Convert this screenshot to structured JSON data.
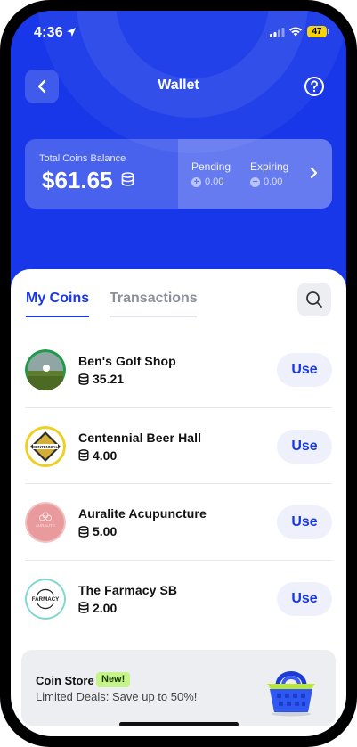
{
  "status_bar": {
    "time": "4:36",
    "battery": "47"
  },
  "header": {
    "title": "Wallet"
  },
  "balance": {
    "label": "Total Coins Balance",
    "amount": "$61.65",
    "pending_label": "Pending",
    "pending_value": "0.00",
    "expiring_label": "Expiring",
    "expiring_value": "0.00"
  },
  "tabs": {
    "my_coins": "My Coins",
    "transactions": "Transactions"
  },
  "merchants": [
    {
      "name": "Ben's Golf Shop",
      "coins": "35.21",
      "use": "Use",
      "icon": "golf-ball-icon"
    },
    {
      "name": "Centennial Beer Hall",
      "coins": "4.00",
      "use": "Use",
      "icon": "centennial-logo"
    },
    {
      "name": "Auralite Acupuncture",
      "coins": "5.00",
      "use": "Use",
      "icon": "auralite-logo"
    },
    {
      "name": "The Farmacy SB",
      "coins": "2.00",
      "use": "Use",
      "icon": "farmacy-logo"
    }
  ],
  "logo_text": {
    "centennial": "CENTENNIAL",
    "auralite": "AURALITE",
    "farmacy": "FARMACY"
  },
  "store": {
    "title": "Coin Store",
    "badge": "New!",
    "subtitle": "Limited Deals: Save up to 50%!"
  },
  "colors": {
    "brand_blue": "#1737e8",
    "badge_green": "#c4f48a"
  }
}
